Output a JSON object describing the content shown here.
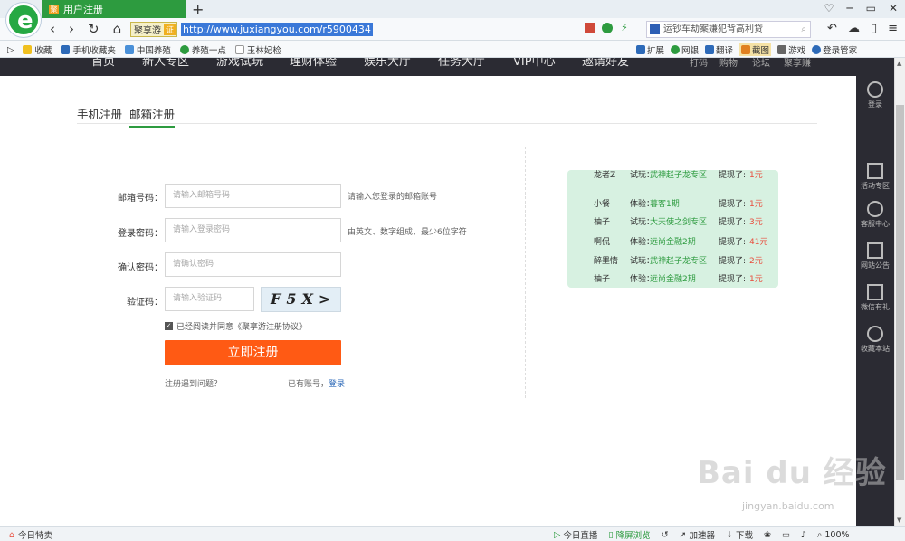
{
  "browser": {
    "tab_title": "用户注册",
    "new_tab": "+",
    "site_name": "聚享游",
    "site_cert": "证",
    "url": "http://www.juxiangyou.com/r5900434",
    "search_text": "运钞车劫案嫌犯背高利贷",
    "nav": {
      "back": "‹",
      "forward": "›",
      "reload": "↻",
      "home": "⌂"
    },
    "window": {
      "min": "─",
      "max": "▭",
      "close": "✕",
      "skin": "♡"
    }
  },
  "bookmarks": {
    "left": [
      {
        "label": "收藏",
        "color": "#f0c020"
      },
      {
        "label": "手机收藏夹",
        "color": "#2d6ab8"
      },
      {
        "label": "中国养殖",
        "color": "#4a90d8"
      },
      {
        "label": "养殖一点",
        "color": "#2d9b3f"
      },
      {
        "label": "玉林妃检",
        "color": "#999999"
      }
    ],
    "right": [
      {
        "label": "扩展",
        "color": "#2d6ab8"
      },
      {
        "label": "网银",
        "color": "#2d9b3f"
      },
      {
        "label": "翻译",
        "color": "#2d6ab8"
      },
      {
        "label": "截图",
        "color": "#e08020",
        "highlight": true
      },
      {
        "label": "游戏",
        "color": "#666666"
      },
      {
        "label": "登录管家",
        "color": "#2d6ab8"
      }
    ]
  },
  "site_nav": {
    "items": [
      "首页",
      "新人专区",
      "游戏试玩",
      "理财体验",
      "娱乐大厅",
      "任务大厅",
      "VIP中心",
      "邀请好友"
    ],
    "right_items": [
      "打码",
      "购物",
      "论坛",
      "聚享赚"
    ]
  },
  "sidebar": {
    "items": [
      "登录",
      "活动专区",
      "客服中心",
      "网站公告",
      "微信有礼",
      "收藏本站"
    ]
  },
  "register": {
    "tabs": [
      "手机注册",
      "邮箱注册"
    ],
    "active_tab": 1,
    "fields": [
      {
        "label": "邮箱号码：",
        "placeholder": "请输入邮箱号码",
        "hint": "请输入您登录的邮箱账号"
      },
      {
        "label": "登录密码：",
        "placeholder": "请输入登录密码",
        "hint": "由英文、数字组成，最少6位字符"
      },
      {
        "label": "确认密码：",
        "placeholder": "请确认密码",
        "hint": ""
      },
      {
        "label": "验证码：",
        "placeholder": "请输入验证码",
        "hint": ""
      }
    ],
    "captcha_text": "F5X>",
    "agree_text": "已经阅读并同意《聚享游注册协议》",
    "submit_label": "立即注册",
    "help_text": "注册遇到问题？",
    "have_account": "已有账号，",
    "login_link": "登录"
  },
  "winners": [
    {
      "name": "龙者Z",
      "type": "试玩：",
      "item": "武神赵子龙专区",
      "prefix": "提现了:",
      "amount": "1元"
    },
    {
      "name": "小餐",
      "type": "体验：",
      "item": "暮客1期",
      "prefix": "提现了:",
      "amount": "1元"
    },
    {
      "name": "柚子",
      "type": "试玩：",
      "item": "大天使之剑专区",
      "prefix": "提现了:",
      "amount": "3元"
    },
    {
      "name": "啊侃",
      "type": "体验：",
      "item": "远尚金融2期",
      "prefix": "提现了:",
      "amount": "41元"
    },
    {
      "name": "醉墨情",
      "type": "试玩：",
      "item": "武神赵子龙专区",
      "prefix": "提现了:",
      "amount": "2元"
    },
    {
      "name": "柚子",
      "type": "体验：",
      "item": "远尚金融2期",
      "prefix": "提现了:",
      "amount": "1元"
    }
  ],
  "statusbar": {
    "left": "今日特卖",
    "right": [
      "今日直播",
      "降屏浏览",
      "加速器",
      "下载",
      "100%"
    ]
  },
  "watermark": {
    "brand": "Bai du 经验",
    "domain": "jingyan.baidu.com"
  }
}
